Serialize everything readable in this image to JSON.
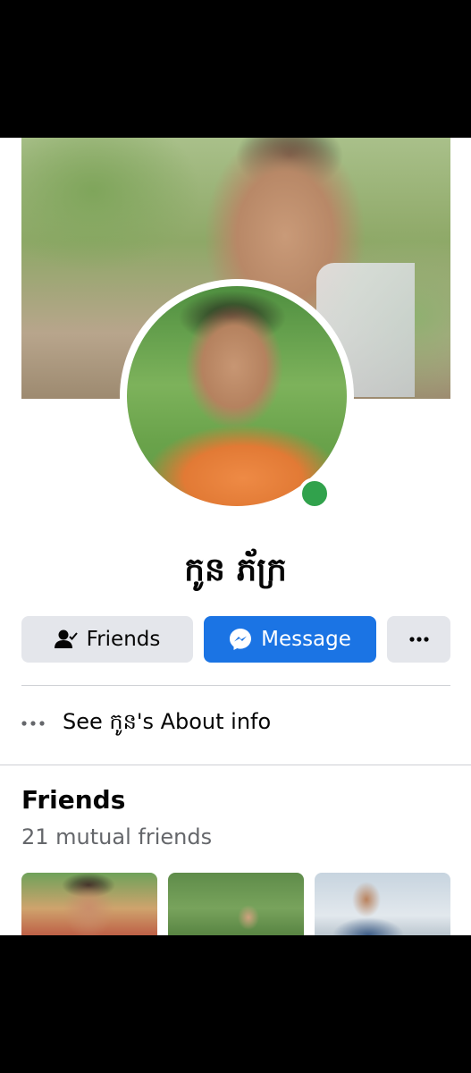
{
  "profile": {
    "name": "កូន ភ័ក្រ",
    "online": true
  },
  "actions": {
    "friends_label": "Friends",
    "message_label": "Message",
    "more_label": "More"
  },
  "about": {
    "text": "See កូន's About info"
  },
  "friends_section": {
    "title": "Friends",
    "subtitle": "21 mutual friends"
  },
  "colors": {
    "accent": "#1b74e4",
    "online": "#31a24c",
    "button_gray": "#e4e6eb"
  },
  "icons": {
    "friends": "person-check-icon",
    "message": "messenger-icon",
    "more": "more-horizontal-icon",
    "about": "more-dots-icon"
  }
}
